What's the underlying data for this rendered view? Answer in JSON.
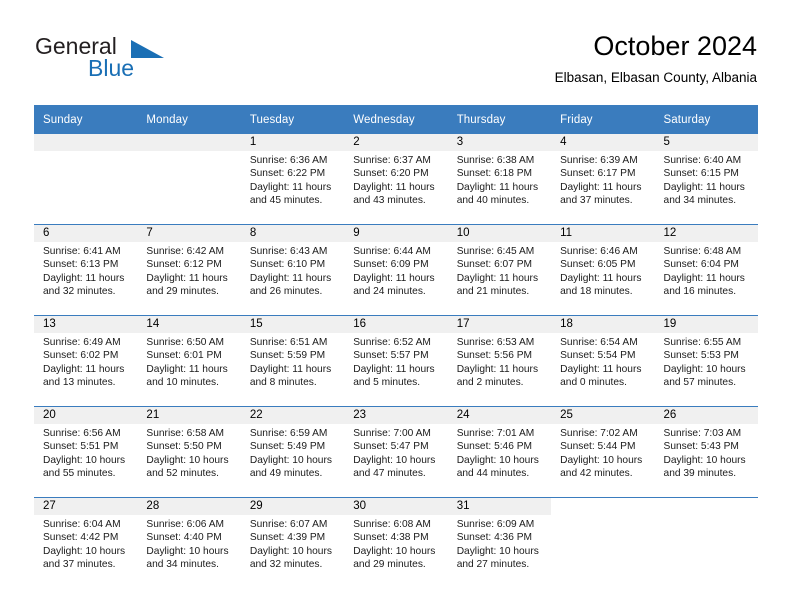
{
  "brand": {
    "word1": "General",
    "word2": "Blue",
    "flag_icon": "brand-flag-icon"
  },
  "header": {
    "title": "October 2024",
    "location": "Elbasan, Elbasan County, Albania"
  },
  "colors": {
    "header_blue": "#3a7cbe",
    "brand_blue": "#1a6fb5",
    "daynum_band": "#f0f0f0",
    "text": "#000000"
  },
  "weekday_headers": [
    "Sunday",
    "Monday",
    "Tuesday",
    "Wednesday",
    "Thursday",
    "Friday",
    "Saturday"
  ],
  "weeks": [
    [
      {
        "day": "",
        "sunrise": "",
        "sunset": "",
        "daylight": "",
        "empty": true
      },
      {
        "day": "",
        "sunrise": "",
        "sunset": "",
        "daylight": "",
        "empty": true
      },
      {
        "day": "1",
        "sunrise": "Sunrise: 6:36 AM",
        "sunset": "Sunset: 6:22 PM",
        "daylight": "Daylight: 11 hours and 45 minutes."
      },
      {
        "day": "2",
        "sunrise": "Sunrise: 6:37 AM",
        "sunset": "Sunset: 6:20 PM",
        "daylight": "Daylight: 11 hours and 43 minutes."
      },
      {
        "day": "3",
        "sunrise": "Sunrise: 6:38 AM",
        "sunset": "Sunset: 6:18 PM",
        "daylight": "Daylight: 11 hours and 40 minutes."
      },
      {
        "day": "4",
        "sunrise": "Sunrise: 6:39 AM",
        "sunset": "Sunset: 6:17 PM",
        "daylight": "Daylight: 11 hours and 37 minutes."
      },
      {
        "day": "5",
        "sunrise": "Sunrise: 6:40 AM",
        "sunset": "Sunset: 6:15 PM",
        "daylight": "Daylight: 11 hours and 34 minutes."
      }
    ],
    [
      {
        "day": "6",
        "sunrise": "Sunrise: 6:41 AM",
        "sunset": "Sunset: 6:13 PM",
        "daylight": "Daylight: 11 hours and 32 minutes."
      },
      {
        "day": "7",
        "sunrise": "Sunrise: 6:42 AM",
        "sunset": "Sunset: 6:12 PM",
        "daylight": "Daylight: 11 hours and 29 minutes."
      },
      {
        "day": "8",
        "sunrise": "Sunrise: 6:43 AM",
        "sunset": "Sunset: 6:10 PM",
        "daylight": "Daylight: 11 hours and 26 minutes."
      },
      {
        "day": "9",
        "sunrise": "Sunrise: 6:44 AM",
        "sunset": "Sunset: 6:09 PM",
        "daylight": "Daylight: 11 hours and 24 minutes."
      },
      {
        "day": "10",
        "sunrise": "Sunrise: 6:45 AM",
        "sunset": "Sunset: 6:07 PM",
        "daylight": "Daylight: 11 hours and 21 minutes."
      },
      {
        "day": "11",
        "sunrise": "Sunrise: 6:46 AM",
        "sunset": "Sunset: 6:05 PM",
        "daylight": "Daylight: 11 hours and 18 minutes."
      },
      {
        "day": "12",
        "sunrise": "Sunrise: 6:48 AM",
        "sunset": "Sunset: 6:04 PM",
        "daylight": "Daylight: 11 hours and 16 minutes."
      }
    ],
    [
      {
        "day": "13",
        "sunrise": "Sunrise: 6:49 AM",
        "sunset": "Sunset: 6:02 PM",
        "daylight": "Daylight: 11 hours and 13 minutes."
      },
      {
        "day": "14",
        "sunrise": "Sunrise: 6:50 AM",
        "sunset": "Sunset: 6:01 PM",
        "daylight": "Daylight: 11 hours and 10 minutes."
      },
      {
        "day": "15",
        "sunrise": "Sunrise: 6:51 AM",
        "sunset": "Sunset: 5:59 PM",
        "daylight": "Daylight: 11 hours and 8 minutes."
      },
      {
        "day": "16",
        "sunrise": "Sunrise: 6:52 AM",
        "sunset": "Sunset: 5:57 PM",
        "daylight": "Daylight: 11 hours and 5 minutes."
      },
      {
        "day": "17",
        "sunrise": "Sunrise: 6:53 AM",
        "sunset": "Sunset: 5:56 PM",
        "daylight": "Daylight: 11 hours and 2 minutes."
      },
      {
        "day": "18",
        "sunrise": "Sunrise: 6:54 AM",
        "sunset": "Sunset: 5:54 PM",
        "daylight": "Daylight: 11 hours and 0 minutes."
      },
      {
        "day": "19",
        "sunrise": "Sunrise: 6:55 AM",
        "sunset": "Sunset: 5:53 PM",
        "daylight": "Daylight: 10 hours and 57 minutes."
      }
    ],
    [
      {
        "day": "20",
        "sunrise": "Sunrise: 6:56 AM",
        "sunset": "Sunset: 5:51 PM",
        "daylight": "Daylight: 10 hours and 55 minutes."
      },
      {
        "day": "21",
        "sunrise": "Sunrise: 6:58 AM",
        "sunset": "Sunset: 5:50 PM",
        "daylight": "Daylight: 10 hours and 52 minutes."
      },
      {
        "day": "22",
        "sunrise": "Sunrise: 6:59 AM",
        "sunset": "Sunset: 5:49 PM",
        "daylight": "Daylight: 10 hours and 49 minutes."
      },
      {
        "day": "23",
        "sunrise": "Sunrise: 7:00 AM",
        "sunset": "Sunset: 5:47 PM",
        "daylight": "Daylight: 10 hours and 47 minutes."
      },
      {
        "day": "24",
        "sunrise": "Sunrise: 7:01 AM",
        "sunset": "Sunset: 5:46 PM",
        "daylight": "Daylight: 10 hours and 44 minutes."
      },
      {
        "day": "25",
        "sunrise": "Sunrise: 7:02 AM",
        "sunset": "Sunset: 5:44 PM",
        "daylight": "Daylight: 10 hours and 42 minutes."
      },
      {
        "day": "26",
        "sunrise": "Sunrise: 7:03 AM",
        "sunset": "Sunset: 5:43 PM",
        "daylight": "Daylight: 10 hours and 39 minutes."
      }
    ],
    [
      {
        "day": "27",
        "sunrise": "Sunrise: 6:04 AM",
        "sunset": "Sunset: 4:42 PM",
        "daylight": "Daylight: 10 hours and 37 minutes."
      },
      {
        "day": "28",
        "sunrise": "Sunrise: 6:06 AM",
        "sunset": "Sunset: 4:40 PM",
        "daylight": "Daylight: 10 hours and 34 minutes."
      },
      {
        "day": "29",
        "sunrise": "Sunrise: 6:07 AM",
        "sunset": "Sunset: 4:39 PM",
        "daylight": "Daylight: 10 hours and 32 minutes."
      },
      {
        "day": "30",
        "sunrise": "Sunrise: 6:08 AM",
        "sunset": "Sunset: 4:38 PM",
        "daylight": "Daylight: 10 hours and 29 minutes."
      },
      {
        "day": "31",
        "sunrise": "Sunrise: 6:09 AM",
        "sunset": "Sunset: 4:36 PM",
        "daylight": "Daylight: 10 hours and 27 minutes."
      },
      {
        "day": "",
        "sunrise": "",
        "sunset": "",
        "daylight": "",
        "blank": true
      },
      {
        "day": "",
        "sunrise": "",
        "sunset": "",
        "daylight": "",
        "blank": true
      }
    ]
  ]
}
